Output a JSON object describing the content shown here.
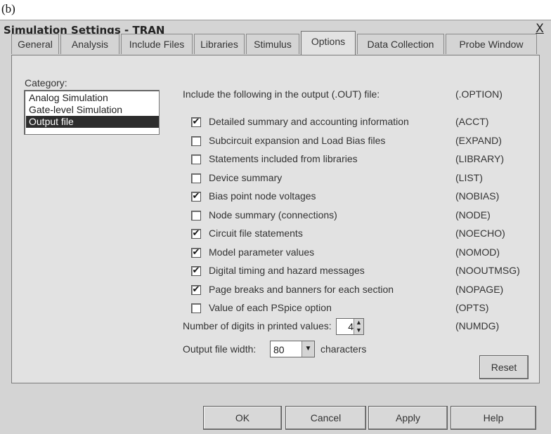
{
  "figure_label": "(b)",
  "window": {
    "title": "Simulation Settings - TRAN",
    "close_label": "X"
  },
  "tabs": [
    {
      "label": "General"
    },
    {
      "label": "Analysis"
    },
    {
      "label": "Include Files"
    },
    {
      "label": "Libraries"
    },
    {
      "label": "Stimulus"
    },
    {
      "label": "Options"
    },
    {
      "label": "Data Collection"
    },
    {
      "label": "Probe Window"
    }
  ],
  "active_tab": "Options",
  "category": {
    "label": "Category:",
    "items": [
      {
        "label": "Analog Simulation",
        "selected": false
      },
      {
        "label": "Gate-level Simulation",
        "selected": false
      },
      {
        "label": "Output file",
        "selected": true
      }
    ]
  },
  "output": {
    "heading": "Include the following in the output (.OUT) file:",
    "column_heading": "(.OPTION)",
    "options": [
      {
        "label": "Detailed summary and accounting information",
        "code": "(ACCT)",
        "checked": true
      },
      {
        "label": "Subcircuit expansion and Load Bias files",
        "code": "(EXPAND)",
        "checked": false
      },
      {
        "label": "Statements included from libraries",
        "code": "(LIBRARY)",
        "checked": false
      },
      {
        "label": "Device summary",
        "code": "(LIST)",
        "checked": false
      },
      {
        "label": "Bias point node voltages",
        "code": "(NOBIAS)",
        "checked": true
      },
      {
        "label": "Node summary (connections)",
        "code": "(NODE)",
        "checked": false
      },
      {
        "label": "Circuit file statements",
        "code": "(NOECHO)",
        "checked": true
      },
      {
        "label": "Model parameter values",
        "code": "(NOMOD)",
        "checked": true
      },
      {
        "label": "Digital timing and hazard messages",
        "code": "(NOOUTMSG)",
        "checked": true
      },
      {
        "label": "Page breaks and banners for each section",
        "code": "(NOPAGE)",
        "checked": true
      },
      {
        "label": "Value of each PSpice option",
        "code": "(OPTS)",
        "checked": false
      }
    ],
    "digits": {
      "label": "Number of digits in printed values:",
      "value": "4",
      "code": "(NUMDG)"
    },
    "width": {
      "label": "Output file width:",
      "value": "80",
      "unit": "characters"
    },
    "reset_label": "Reset"
  },
  "buttons": {
    "ok": "OK",
    "cancel": "Cancel",
    "apply": "Apply",
    "help": "Help"
  }
}
